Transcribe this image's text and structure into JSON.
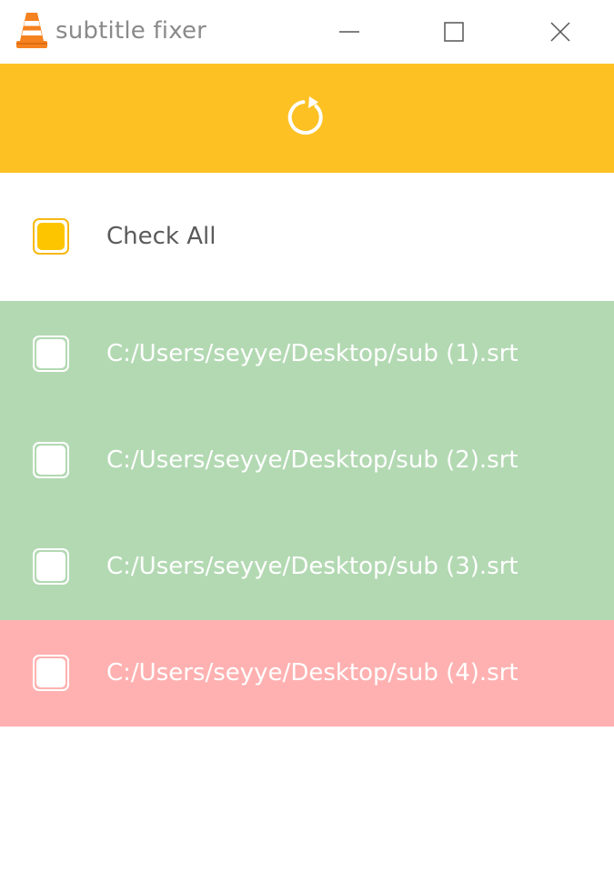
{
  "window": {
    "title": "subtitle fixer",
    "app_icon": "vlc-cone-icon",
    "controls": {
      "minimize_icon": "minimize-icon",
      "maximize_icon": "maximize-icon",
      "close_icon": "close-icon"
    }
  },
  "toolbar": {
    "background": "#fdc124",
    "reload_icon": "reload-icon",
    "icon_color": "#ffffff"
  },
  "check_all": {
    "label": "Check All",
    "checked": false,
    "accent": "#fdc500"
  },
  "files": [
    {
      "path": "C:/Users/seyye/Desktop/sub (1).srt",
      "status": "success",
      "checked": false
    },
    {
      "path": "C:/Users/seyye/Desktop/sub (2).srt",
      "status": "success",
      "checked": false
    },
    {
      "path": "C:/Users/seyye/Desktop/sub (3).srt",
      "status": "success",
      "checked": false
    },
    {
      "path": "C:/Users/seyye/Desktop/sub (4).srt",
      "status": "error",
      "checked": false
    }
  ],
  "colors": {
    "success_row": "#b3d9b3",
    "error_row": "#ffb1b1",
    "title_text": "#8a8a8a"
  }
}
